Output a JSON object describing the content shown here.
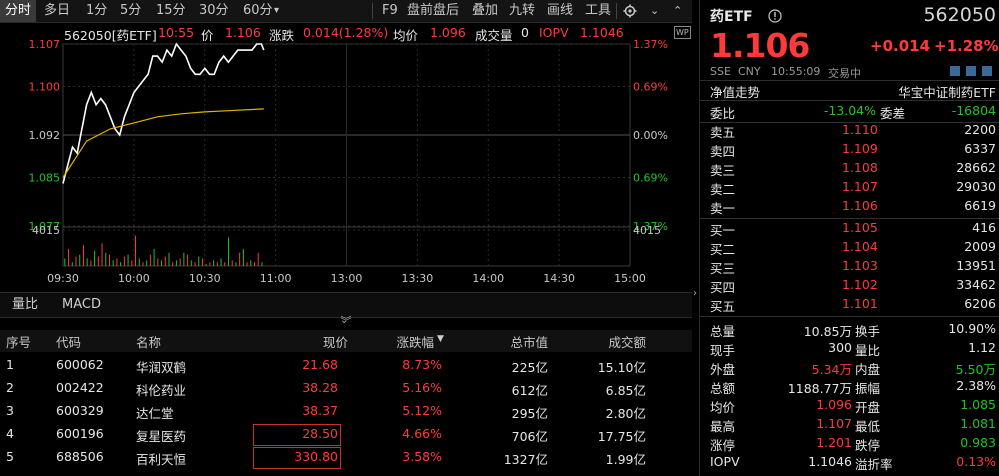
{
  "toolbar": {
    "periods": [
      "分时",
      "多日",
      "1分",
      "5分",
      "15分",
      "30分",
      "60分"
    ],
    "active_period": "分时",
    "dropdown_label": "60分",
    "tools": [
      "F9",
      "盘前盘后",
      "叠加",
      "九转",
      "画线",
      "工具"
    ]
  },
  "info": {
    "code_name": "562050[药ETF]",
    "time": "10:55",
    "price_label": "价",
    "price": "1.106",
    "change_label": "涨跌",
    "change": "0.014(1.28%)",
    "avg_label": "均价",
    "avg": "1.096",
    "volume_label": "成交量",
    "volume": "0",
    "iopv_label": "IOPV",
    "iopv": "1.1046",
    "wp_badge": "WP"
  },
  "chart_data": {
    "type": "line",
    "title": "",
    "prev_close": 1.092,
    "ylim": [
      1.077,
      1.107
    ],
    "left_ticks": [
      "1.107",
      "1.100",
      "1.092",
      "1.085",
      "1.077"
    ],
    "right_ticks": [
      "1.37%",
      "0.69%",
      "0.00%",
      "0.69%",
      "1.37%"
    ],
    "volume_tick": "4015",
    "x_ticks": [
      "09:30",
      "10:00",
      "10:30",
      "11:00",
      "13:00",
      "13:30",
      "14:00",
      "14:30",
      "15:00"
    ],
    "series": [
      {
        "name": "",
        "color": "#ffffff",
        "points": [
          [
            0,
            1.084
          ],
          [
            2,
            1.087
          ],
          [
            4,
            1.09
          ],
          [
            6,
            1.089
          ],
          [
            8,
            1.093
          ],
          [
            10,
            1.097
          ],
          [
            12,
            1.099
          ],
          [
            14,
            1.097
          ],
          [
            16,
            1.098
          ],
          [
            18,
            1.097
          ],
          [
            20,
            1.095
          ],
          [
            22,
            1.093
          ],
          [
            24,
            1.092
          ],
          [
            26,
            1.095
          ],
          [
            28,
            1.097
          ],
          [
            30,
            1.099
          ],
          [
            32,
            1.1
          ],
          [
            34,
            1.101
          ],
          [
            36,
            1.102
          ],
          [
            38,
            1.105
          ],
          [
            40,
            1.105
          ],
          [
            42,
            1.104
          ],
          [
            44,
            1.106
          ],
          [
            46,
            1.105
          ],
          [
            48,
            1.107
          ],
          [
            50,
            1.106
          ],
          [
            52,
            1.105
          ],
          [
            54,
            1.103
          ],
          [
            56,
            1.102
          ],
          [
            58,
            1.102
          ],
          [
            60,
            1.103
          ],
          [
            62,
            1.102
          ],
          [
            64,
            1.102
          ],
          [
            66,
            1.104
          ],
          [
            68,
            1.105
          ],
          [
            70,
            1.104
          ],
          [
            72,
            1.105
          ],
          [
            74,
            1.106
          ],
          [
            76,
            1.106
          ],
          [
            78,
            1.106
          ],
          [
            80,
            1.106
          ],
          [
            82,
            1.107
          ],
          [
            84,
            1.107
          ],
          [
            85,
            1.106
          ]
        ]
      },
      {
        "name": "",
        "color": "#e0b400",
        "points": [
          [
            0,
            1.085
          ],
          [
            5,
            1.088
          ],
          [
            10,
            1.091
          ],
          [
            20,
            1.093
          ],
          [
            30,
            1.094
          ],
          [
            40,
            1.095
          ],
          [
            50,
            1.0955
          ],
          [
            60,
            1.0958
          ],
          [
            70,
            1.096
          ],
          [
            85,
            1.0963
          ]
        ]
      }
    ],
    "volume_bars": [
      0.2,
      0.45,
      0.1,
      0.25,
      0.3,
      0.55,
      0.2,
      0.15,
      0.4,
      0.25,
      0.6,
      0.35,
      0.3,
      0.15,
      0.2,
      0.1,
      0.25,
      0.3,
      0.15,
      0.8,
      0.2,
      0.1,
      0.15,
      0.3,
      0.45,
      0.2,
      0.15,
      0.25,
      0.35,
      0.1,
      0.15,
      0.2,
      0.35,
      0.3,
      0.15,
      0.1,
      0.25,
      0.2,
      0.05,
      0.1,
      0.15,
      0.1,
      0.2,
      0.1,
      0.75,
      0.15,
      0.1,
      0.35,
      0.45,
      0.1,
      0.15,
      0.1,
      0.35,
      0.1
    ],
    "volume_colors": [
      "g",
      "r",
      "g",
      "r",
      "g",
      "r",
      "g",
      "r",
      "g",
      "r",
      "r",
      "g",
      "r",
      "g",
      "r",
      "g",
      "r",
      "g",
      "r",
      "r",
      "g",
      "r",
      "g",
      "r",
      "g",
      "r",
      "g",
      "r",
      "g",
      "r",
      "g",
      "r",
      "g",
      "r",
      "g",
      "r",
      "g",
      "r",
      "g",
      "r",
      "g",
      "r",
      "g",
      "r",
      "g",
      "r",
      "g",
      "r",
      "g",
      "r",
      "g",
      "r",
      "r",
      "g"
    ]
  },
  "indicators": {
    "tabs": [
      "量比",
      "MACD"
    ]
  },
  "table": {
    "headers": [
      "序号",
      "代码",
      "名称",
      "现价",
      "涨跌幅",
      "总市值",
      "成交额"
    ],
    "rows": [
      [
        "1",
        "600062",
        "华润双鹤",
        "21.68",
        "8.73%",
        "225亿",
        "15.10亿"
      ],
      [
        "2",
        "002422",
        "科伦药业",
        "38.28",
        "5.16%",
        "612亿",
        "6.85亿"
      ],
      [
        "3",
        "600329",
        "达仁堂",
        "38.37",
        "5.12%",
        "295亿",
        "2.80亿"
      ],
      [
        "4",
        "600196",
        "复星医药",
        "28.50",
        "4.66%",
        "706亿",
        "17.75亿"
      ],
      [
        "5",
        "688506",
        "百利天恒",
        "330.80",
        "3.58%",
        "1327亿",
        "1.99亿"
      ]
    ]
  },
  "right": {
    "name": "药ETF",
    "info_icon": "info-icon",
    "code": "562050",
    "price": "1.106",
    "change": "+0.014",
    "change_pct": "+1.28%",
    "exchange": "SSE",
    "currency": "CNY",
    "time": "10:55:09",
    "status": "交易中",
    "nav_label": "净值走势",
    "index_label": "华宝中证制药ETF",
    "webi_label": "委比",
    "webi": "-13.04%",
    "weicha_label": "委差",
    "weicha": "-16804",
    "asks": [
      {
        "label": "卖五",
        "price": "1.110",
        "vol": "2200"
      },
      {
        "label": "卖四",
        "price": "1.109",
        "vol": "6337"
      },
      {
        "label": "卖三",
        "price": "1.108",
        "vol": "28662"
      },
      {
        "label": "卖二",
        "price": "1.107",
        "vol": "29030"
      },
      {
        "label": "卖一",
        "price": "1.106",
        "vol": "6619"
      }
    ],
    "bids": [
      {
        "label": "买一",
        "price": "1.105",
        "vol": "416"
      },
      {
        "label": "买二",
        "price": "1.104",
        "vol": "2009"
      },
      {
        "label": "买三",
        "price": "1.103",
        "vol": "13951"
      },
      {
        "label": "买四",
        "price": "1.102",
        "vol": "33462"
      },
      {
        "label": "买五",
        "price": "1.101",
        "vol": "6206"
      }
    ],
    "stats": [
      {
        "l1": "总量",
        "v1": "10.85万",
        "c1": "w",
        "l2": "换手",
        "v2": "10.90%",
        "c2": "w"
      },
      {
        "l1": "现手",
        "v1": "300",
        "c1": "w",
        "l2": "量比",
        "v2": "1.12",
        "c2": "w"
      },
      {
        "l1": "外盘",
        "v1": "5.34万",
        "c1": "r",
        "l2": "内盘",
        "v2": "5.50万",
        "c2": "g"
      },
      {
        "l1": "总额",
        "v1": "1188.77万",
        "c1": "w",
        "l2": "振幅",
        "v2": "2.38%",
        "c2": "w"
      },
      {
        "l1": "均价",
        "v1": "1.096",
        "c1": "r",
        "l2": "开盘",
        "v2": "1.085",
        "c2": "g"
      },
      {
        "l1": "最高",
        "v1": "1.107",
        "c1": "r",
        "l2": "最低",
        "v2": "1.081",
        "c2": "g"
      },
      {
        "l1": "涨停",
        "v1": "1.201",
        "c1": "r",
        "l2": "跌停",
        "v2": "0.983",
        "c2": "g"
      },
      {
        "l1": "IOPV",
        "v1": "1.1046",
        "c1": "w",
        "l2": "溢折率",
        "v2": "0.13%",
        "c2": "r"
      }
    ]
  }
}
